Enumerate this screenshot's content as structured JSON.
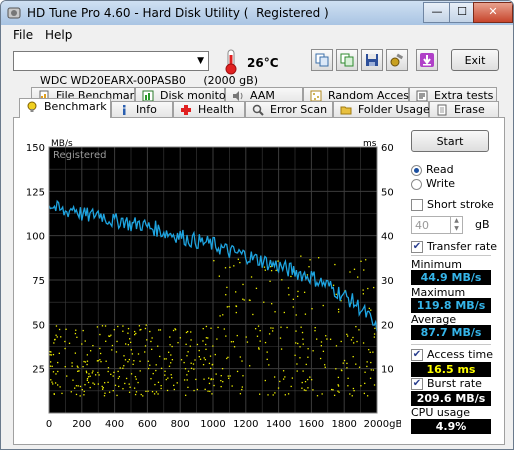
{
  "window": {
    "title": "HD Tune Pro 4.60 - Hard Disk Utility (  Registered )",
    "minimize": "—",
    "maximize": "☐",
    "close": "✕"
  },
  "menu": {
    "file": "File",
    "help": "Help"
  },
  "toolbar": {
    "drive": "WDC WD20EARX-00PASB0     (2000 gB)",
    "temperature": "26°C",
    "exit_label": "Exit"
  },
  "tabs_top": [
    {
      "label": "File Benchmark"
    },
    {
      "label": "Disk monitor"
    },
    {
      "label": "AAM"
    },
    {
      "label": "Random Access"
    },
    {
      "label": "Extra tests"
    }
  ],
  "tabs_bottom": [
    {
      "label": "Benchmark"
    },
    {
      "label": "Info"
    },
    {
      "label": "Health"
    },
    {
      "label": "Error Scan"
    },
    {
      "label": "Folder Usage"
    },
    {
      "label": "Erase"
    }
  ],
  "side": {
    "start_label": "Start",
    "read_label": "Read",
    "write_label": "Write",
    "short_stroke_label": "Short stroke",
    "short_stroke_value": "40",
    "short_stroke_unit": "gB",
    "transfer_rate_label": "Transfer rate",
    "minimum_label": "Minimum",
    "minimum_value": "44.9 MB/s",
    "maximum_label": "Maximum",
    "maximum_value": "119.8 MB/s",
    "average_label": "Average",
    "average_value": "87.7 MB/s",
    "access_time_label": "Access time",
    "access_time_value": "16.5 ms",
    "burst_rate_label": "Burst rate",
    "burst_rate_value": "209.6 MB/s",
    "cpu_usage_label": "CPU usage",
    "cpu_usage_value": "4.9%"
  },
  "chart_data": {
    "type": "line",
    "watermark": "Registered",
    "ylabel_left": "MB/s",
    "ylabel_right": "ms",
    "xlabel_unit": "gB",
    "xlim": [
      0,
      2000
    ],
    "ylim_left": [
      0,
      150
    ],
    "ylim_right": [
      0,
      60
    ],
    "x_ticks": [
      "0",
      "200",
      "400",
      "600",
      "800",
      "1000",
      "1200",
      "1400",
      "1600",
      "1800",
      "2000gB"
    ],
    "y_ticks_left": [
      "150",
      "125",
      "100",
      "75",
      "50",
      "25"
    ],
    "y_ticks_right": [
      "60",
      "50",
      "40",
      "30",
      "20",
      "10"
    ],
    "grid": true,
    "colors": {
      "transfer": "#1ea4e0",
      "access": "#f2f200",
      "background": "#000000",
      "grid": "#3c3c3c"
    },
    "series": [
      {
        "name": "Transfer rate",
        "x": [
          0,
          50,
          100,
          150,
          200,
          250,
          300,
          350,
          400,
          450,
          500,
          550,
          600,
          650,
          700,
          750,
          800,
          850,
          900,
          950,
          1000,
          1050,
          1100,
          1150,
          1200,
          1250,
          1300,
          1350,
          1400,
          1450,
          1500,
          1550,
          1600,
          1650,
          1700,
          1750,
          1800,
          1850,
          1900,
          1950,
          2000
        ],
        "values": [
          118,
          115,
          113,
          116,
          112,
          111,
          113,
          110,
          108,
          109,
          106,
          107,
          105,
          104,
          102,
          101,
          100,
          98,
          97,
          96,
          95,
          93,
          91,
          90,
          89,
          87,
          86,
          84,
          83,
          81,
          80,
          78,
          77,
          74,
          72,
          69,
          66,
          63,
          59,
          54,
          46
        ]
      }
    ]
  }
}
